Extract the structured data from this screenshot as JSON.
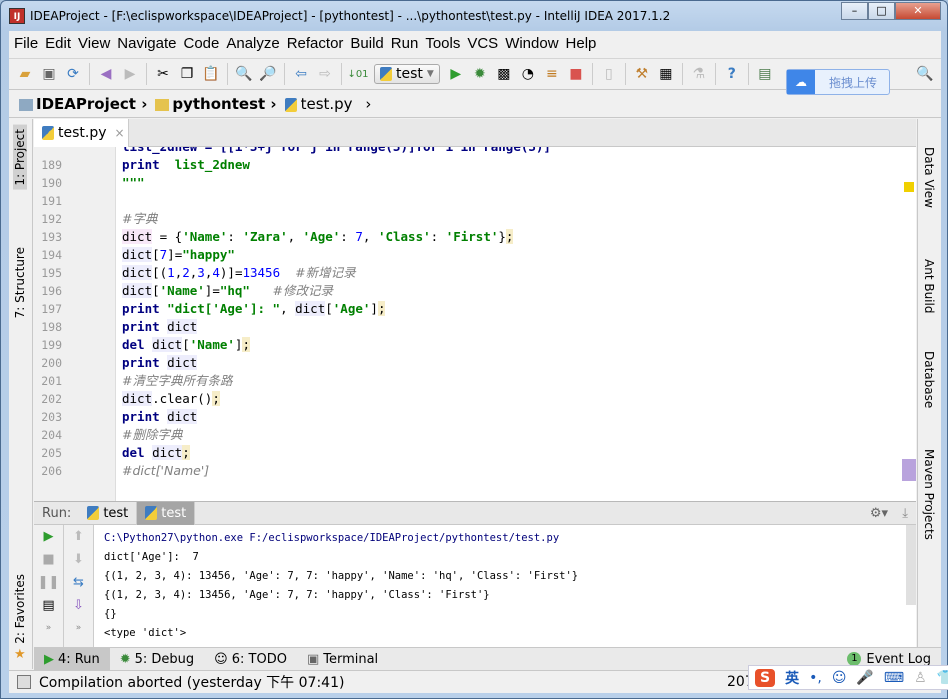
{
  "window": {
    "title": "IDEAProject - [F:\\eclispworkspace\\IDEAProject] - [pythontest] - ...\\pythontest\\test.py - IntelliJ IDEA 2017.1.2",
    "icon": "IJ",
    "minimize": "–",
    "maximize": "□",
    "close": "✕"
  },
  "menu": [
    "File",
    "Edit",
    "View",
    "Navigate",
    "Code",
    "Analyze",
    "Refactor",
    "Build",
    "Run",
    "Tools",
    "VCS",
    "Window",
    "Help"
  ],
  "toolbar": {
    "run_config": "test",
    "upload_label": "拖拽上传"
  },
  "breadcrumb": [
    "IDEAProject",
    "pythontest",
    "test.py"
  ],
  "left_strip": [
    "1: Project",
    "7: Structure",
    "2: Favorites"
  ],
  "right_strip": [
    "Data View",
    "Ant Build",
    "Database",
    "Maven Projects"
  ],
  "editor_tab": {
    "label": "test.py",
    "close": "×"
  },
  "code_lines": [
    {
      "n": "189",
      "t": [
        [
          "kw",
          "print"
        ],
        [
          "",
          "  "
        ],
        [
          "str",
          "list_2dnew"
        ]
      ]
    },
    {
      "n": "190",
      "t": [
        [
          "str",
          "\"\"\""
        ]
      ]
    },
    {
      "n": "191",
      "t": []
    },
    {
      "n": "192",
      "t": [
        [
          "cm",
          "#字典"
        ]
      ]
    },
    {
      "n": "193",
      "t": [
        [
          "hlp",
          "dict"
        ],
        [
          "",
          " = {"
        ],
        [
          "str",
          "'Name'"
        ],
        [
          "",
          ": "
        ],
        [
          "str",
          "'Zara'"
        ],
        [
          "",
          ", "
        ],
        [
          "str",
          "'Age'"
        ],
        [
          "",
          ": "
        ],
        [
          "num",
          "7"
        ],
        [
          "",
          ", "
        ],
        [
          "str",
          "'Class'"
        ],
        [
          "",
          ": "
        ],
        [
          "str",
          "'First'"
        ],
        [
          "",
          "}"
        ],
        [
          "semi",
          ";"
        ]
      ]
    },
    {
      "n": "194",
      "t": [
        [
          "hl",
          "dict"
        ],
        [
          "",
          "["
        ],
        [
          "num",
          "7"
        ],
        [
          "",
          "]="
        ],
        [
          "str",
          "\"happy\""
        ]
      ]
    },
    {
      "n": "195",
      "t": [
        [
          "hl",
          "dict"
        ],
        [
          "",
          "[("
        ],
        [
          "num",
          "1"
        ],
        [
          "",
          ","
        ],
        [
          "num",
          "2"
        ],
        [
          "",
          ","
        ],
        [
          "num",
          "3"
        ],
        [
          "",
          ","
        ],
        [
          "num",
          "4"
        ],
        [
          "",
          ")]="
        ],
        [
          "num",
          "13456"
        ],
        [
          "",
          "  "
        ],
        [
          "cm",
          "#新增记录"
        ]
      ]
    },
    {
      "n": "196",
      "t": [
        [
          "hl",
          "dict"
        ],
        [
          "",
          "["
        ],
        [
          "str",
          "'Name'"
        ],
        [
          "",
          "]="
        ],
        [
          "str",
          "\"hq\""
        ],
        [
          "",
          "   "
        ],
        [
          "cm",
          "#修改记录"
        ]
      ]
    },
    {
      "n": "197",
      "t": [
        [
          "kw",
          "print"
        ],
        [
          "",
          " "
        ],
        [
          "str",
          "\"dict['Age']: \""
        ],
        [
          "",
          ", "
        ],
        [
          "hl",
          "dict"
        ],
        [
          "",
          "["
        ],
        [
          "str",
          "'Age'"
        ],
        [
          "",
          "]"
        ],
        [
          "semi",
          ";"
        ]
      ]
    },
    {
      "n": "198",
      "t": [
        [
          "kw",
          "print"
        ],
        [
          "",
          " "
        ],
        [
          "hl",
          "dict"
        ]
      ]
    },
    {
      "n": "199",
      "t": [
        [
          "kw",
          "del"
        ],
        [
          "",
          " "
        ],
        [
          "hl",
          "dict"
        ],
        [
          "",
          "["
        ],
        [
          "str",
          "'Name'"
        ],
        [
          "",
          "]"
        ],
        [
          "semi",
          ";"
        ]
      ]
    },
    {
      "n": "200",
      "t": [
        [
          "kw",
          "print"
        ],
        [
          "",
          " "
        ],
        [
          "hl",
          "dict"
        ]
      ]
    },
    {
      "n": "201",
      "t": [
        [
          "cm",
          "#清空字典所有条路"
        ]
      ]
    },
    {
      "n": "202",
      "t": [
        [
          "hl",
          "dict"
        ],
        [
          "",
          ".clear()"
        ],
        [
          "semi",
          ";"
        ]
      ]
    },
    {
      "n": "203",
      "t": [
        [
          "kw",
          "print"
        ],
        [
          "",
          " "
        ],
        [
          "hl",
          "dict"
        ]
      ]
    },
    {
      "n": "204",
      "t": [
        [
          "cm",
          "#删除字典"
        ]
      ]
    },
    {
      "n": "205",
      "t": [
        [
          "kw",
          "del"
        ],
        [
          "",
          " "
        ],
        [
          "hl",
          "dict"
        ],
        [
          "semi",
          ";"
        ]
      ]
    },
    {
      "n": "206",
      "t": [
        [
          "cm",
          "#dict['Name']"
        ]
      ]
    }
  ],
  "run_panel": {
    "label": "Run:",
    "tabs": [
      "test",
      "test"
    ],
    "output": [
      "C:\\Python27\\python.exe F:/eclispworkspace/IDEAProject/pythontest/test.py",
      "dict['Age']:  7",
      "{(1, 2, 3, 4): 13456, 'Age': 7, 7: 'happy', 'Name': 'hq', 'Class': 'First'}",
      "{(1, 2, 3, 4): 13456, 'Age': 7, 7: 'happy', 'Class': 'First'}",
      "{}",
      "<type 'dict'>"
    ]
  },
  "bottom_tabs": [
    "4: Run",
    "5: Debug",
    "6: TODO",
    "Terminal"
  ],
  "event_log": {
    "count": "1",
    "label": "Event Log"
  },
  "status": {
    "message": "Compilation aborted (yesterday 下午 07:41)",
    "position": "207:"
  },
  "ime": {
    "mode": "英"
  }
}
